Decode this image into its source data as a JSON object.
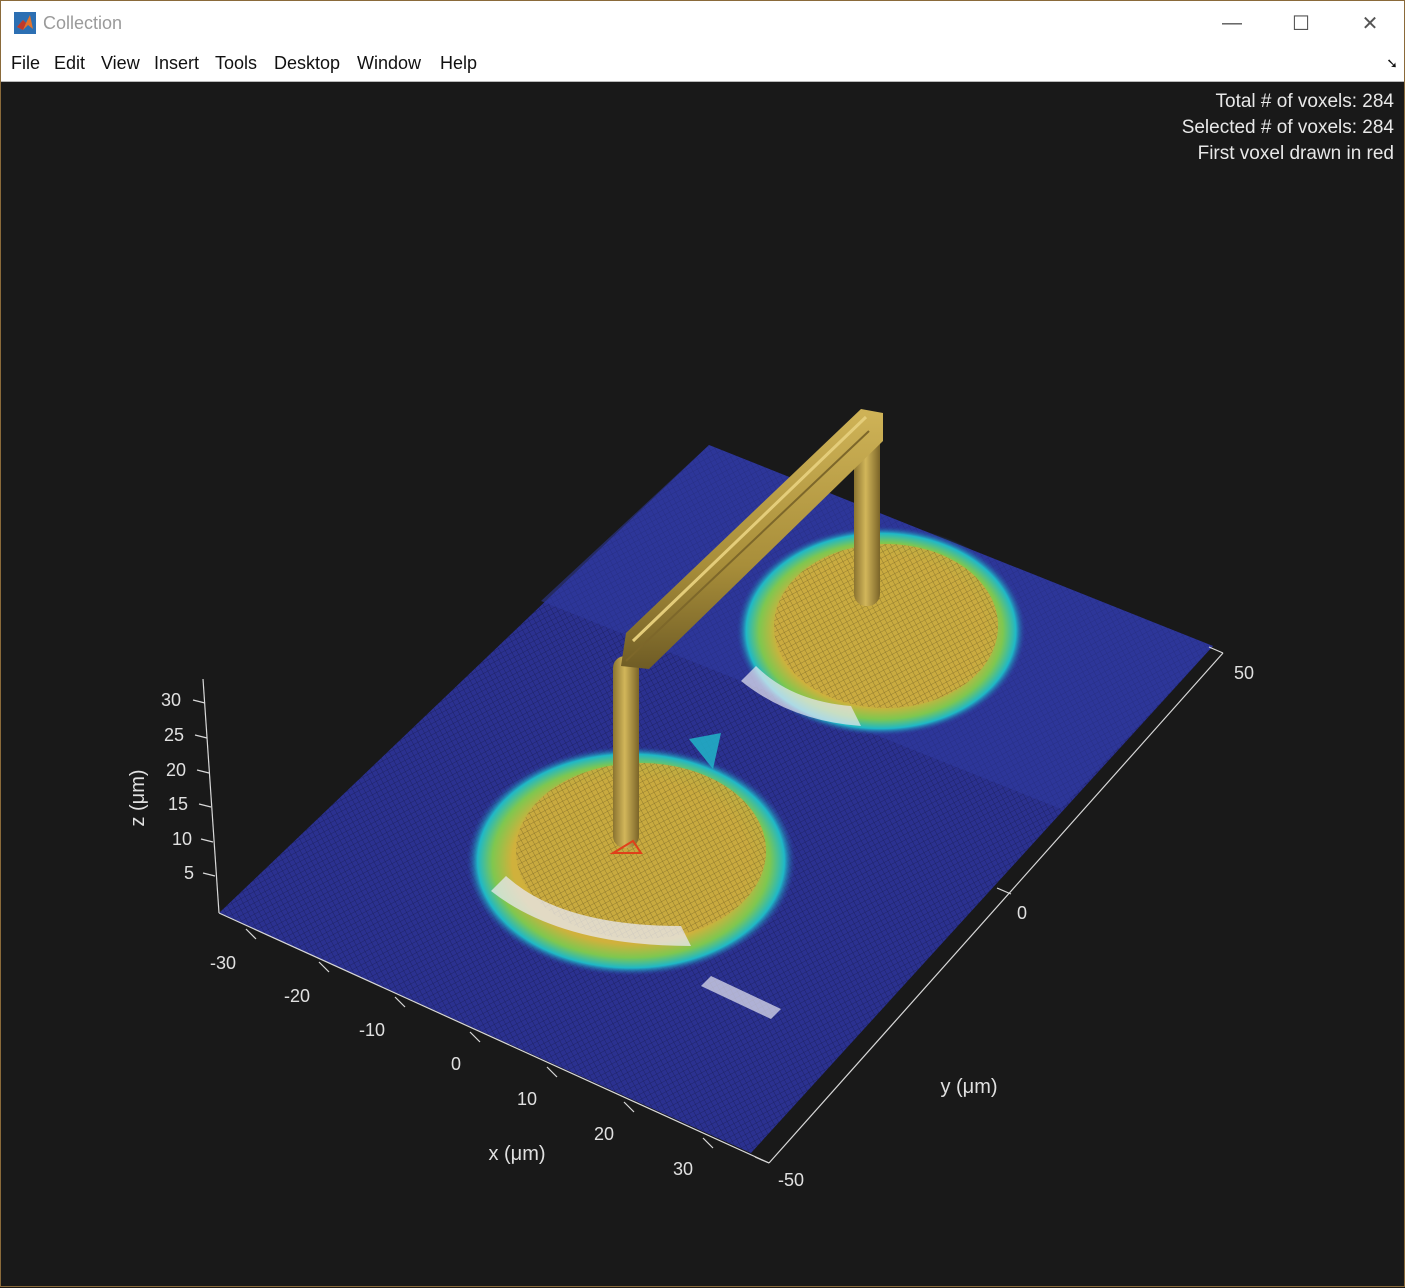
{
  "window": {
    "title": "Collection",
    "minimize_glyph": "—",
    "maximize_glyph": "☐",
    "close_glyph": "✕"
  },
  "menu": {
    "items": [
      "File",
      "Edit",
      "View",
      "Insert",
      "Tools",
      "Desktop",
      "Window",
      "Help"
    ],
    "dock_glyph": "➘"
  },
  "info": {
    "total": "Total # of voxels: 284",
    "selected": "Selected # of voxels: 284",
    "first": "First voxel drawn in red"
  },
  "axes": {
    "x_label": "x (μm)",
    "y_label": "y (μm)",
    "z_label": "z (μm)",
    "x_ticks": [
      "-30",
      "-20",
      "-10",
      "0",
      "10",
      "20",
      "30"
    ],
    "y_ticks": [
      "-50",
      "0",
      "50"
    ],
    "z_ticks": [
      "5",
      "10",
      "15",
      "20",
      "25",
      "30"
    ]
  },
  "colors": {
    "background": "#191919",
    "surface_low": "#2a2f8f",
    "surface_mid": "#21b5c9",
    "surface_high": "#d8b13a",
    "structure": "#b89a3a",
    "first_voxel": "#e0401a"
  }
}
